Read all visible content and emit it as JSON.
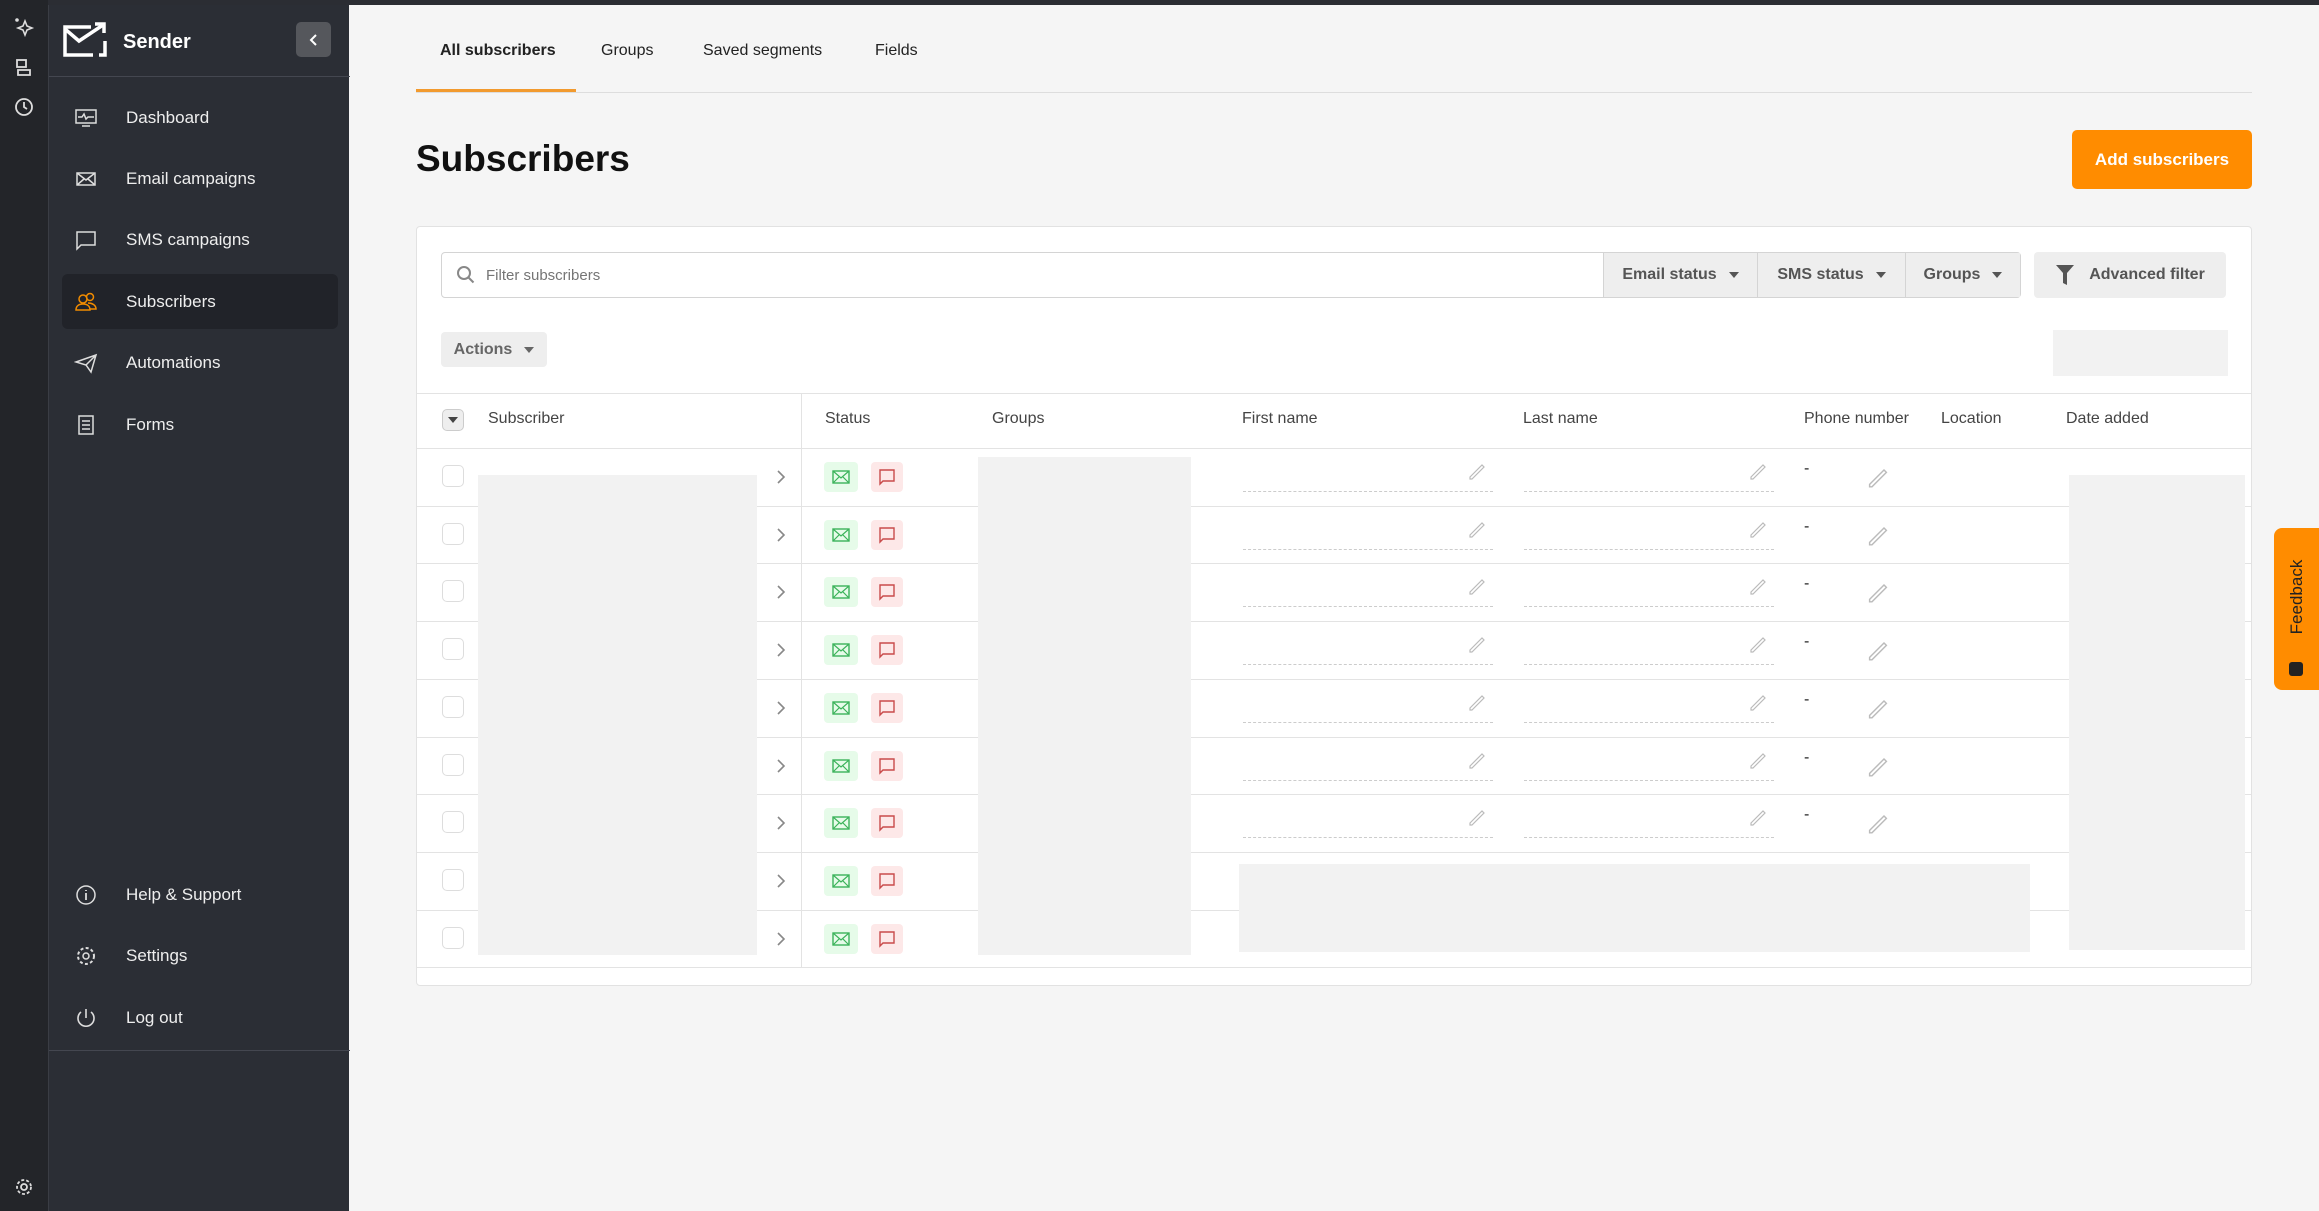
{
  "app": {
    "name": "Sender"
  },
  "sidebar": {
    "items": [
      {
        "label": "Dashboard",
        "icon": "dashboard-icon"
      },
      {
        "label": "Email campaigns",
        "icon": "envelope-icon"
      },
      {
        "label": "SMS campaigns",
        "icon": "chat-bubble-icon"
      },
      {
        "label": "Subscribers",
        "icon": "users-icon",
        "active": true
      },
      {
        "label": "Automations",
        "icon": "paper-plane-icon"
      },
      {
        "label": "Forms",
        "icon": "form-icon"
      }
    ],
    "bottom_items": [
      {
        "label": "Help & Support",
        "icon": "info-icon"
      },
      {
        "label": "Settings",
        "icon": "gear-icon"
      },
      {
        "label": "Log out",
        "icon": "power-icon"
      }
    ]
  },
  "tabs": [
    "All subscribers",
    "Groups",
    "Saved segments",
    "Fields"
  ],
  "page": {
    "title": "Subscribers",
    "add_button": "Add subscribers"
  },
  "filters": {
    "search_placeholder": "Filter subscribers",
    "email_status": "Email status",
    "sms_status": "SMS status",
    "groups": "Groups",
    "advanced": "Advanced filter",
    "actions": "Actions"
  },
  "table": {
    "columns": [
      "Subscriber",
      "Status",
      "Groups",
      "First name",
      "Last name",
      "Phone number",
      "Location",
      "Date added"
    ],
    "rows": [
      {
        "phone": "-"
      },
      {
        "phone": "-"
      },
      {
        "phone": "-"
      },
      {
        "phone": "-"
      },
      {
        "phone": "-"
      },
      {
        "phone": "-"
      },
      {
        "phone": "-"
      },
      {
        "phone": ""
      },
      {
        "phone": ""
      }
    ]
  },
  "feedback": "Feedback",
  "colors": {
    "accent": "#ff8c00",
    "sidebar": "#2b2e35",
    "email_ok": "#e6fbe9",
    "sms_bad": "#fde8e8"
  }
}
